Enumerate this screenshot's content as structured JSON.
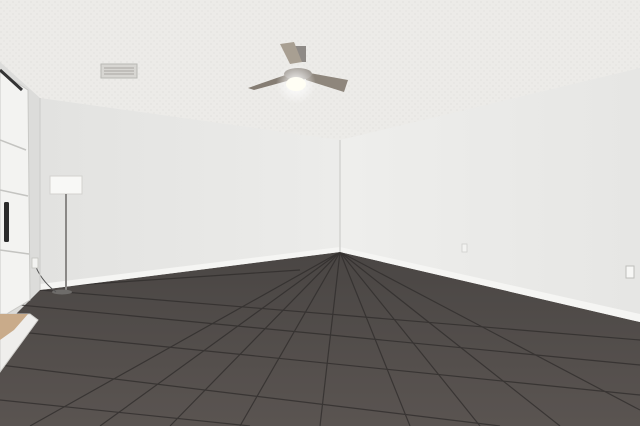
{
  "scene": {
    "description_items": [
      "textured-ceiling",
      "ceiling-fan",
      "air-vent",
      "left-wall",
      "right-wall",
      "back-wall",
      "floor-lamp",
      "door",
      "tile-floor",
      "baseboards",
      "outlets"
    ]
  },
  "colors": {
    "ceiling": "#ecebe8",
    "wall_back": "#e8e8e6",
    "wall_right": "#ececea",
    "wall_left": "#dfdfdd",
    "floor_dark": "#3d3a39",
    "floor_mid": "#56514f",
    "grout": "#2c2a29",
    "baseboard": "#f4f4f2",
    "fan_blade": "#9a938a",
    "fan_light": "#fffef6",
    "door": "#f2f2f0",
    "handle": "#2a2a2a"
  }
}
